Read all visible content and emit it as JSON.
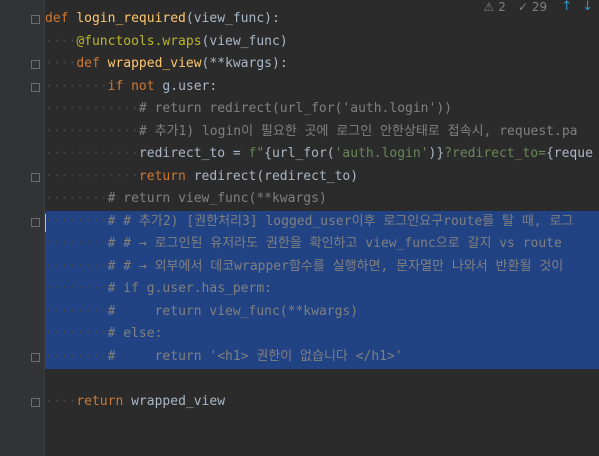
{
  "status": {
    "warnings": "2",
    "weak_warnings": "29"
  },
  "code": {
    "l1_kw": "def",
    "l1_fn": "login_required",
    "l1_rest": "(view_func):",
    "l2_dec": "@functools.wraps",
    "l2_rest": "(view_func)",
    "l3_kw": "def",
    "l3_fn": "wrapped_view",
    "l3_rest": "(**kwargs):",
    "l4_kw1": "if",
    "l4_kw2": "not",
    "l4_rest": "g.user:",
    "l5": "# return redirect(url_for('auth.login'))",
    "l6": "# 추가1) login이 필요한 곳에 로그인 안한상태로 접속시, request.pa",
    "l7_a": "redirect_to = ",
    "l7_str1": "f\"",
    "l7_b": "{url_for(",
    "l7_str2": "'auth.login'",
    "l7_c": ")}",
    "l7_str3": "?redirect_to=",
    "l7_d": "{reque",
    "l8_kw": "return",
    "l8_rest": "redirect(redirect_to)",
    "l9": "# return view_func(**kwargs)",
    "l10": "# # 추가2) [권한처리3] logged_user이후 로그인요구route를 탈 때, 로그",
    "l11": "# # → 로그인된 유저라도 권한을 확인하고 view_func으로 갈지 vs route",
    "l12": "# # → 외부에서 데코wrapper함수를 실행하면, 문자열만 나와서 반환될 것이",
    "l13": "# if g.user.has_perm:",
    "l14": "#     return view_func(**kwargs)",
    "l15": "# else:",
    "l16": "#     return '<h1> 권한이 없습니다 </h1>'",
    "l18_kw": "return",
    "l18_rest": "wrapped_view"
  }
}
